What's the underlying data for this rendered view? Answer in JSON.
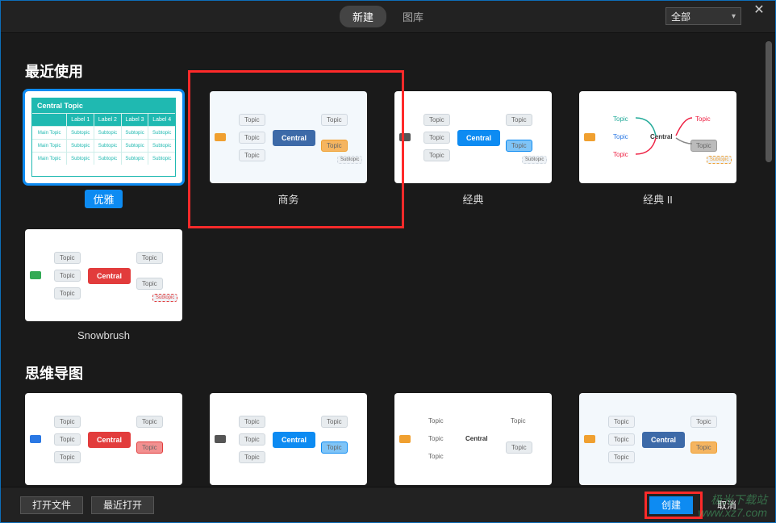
{
  "topbar": {
    "tabs": {
      "new": "新建",
      "gallery": "图库"
    },
    "filter": {
      "selected": "全部"
    }
  },
  "sections": {
    "recent": {
      "title": "最近使用",
      "items": [
        {
          "label": "优雅"
        },
        {
          "label": "商务"
        },
        {
          "label": "经典"
        },
        {
          "label": "经典 II"
        },
        {
          "label": "Snowbrush"
        }
      ]
    },
    "mindmap": {
      "title": "思维导图",
      "items": [
        {
          "label": ""
        },
        {
          "label": ""
        },
        {
          "label": ""
        },
        {
          "label": ""
        }
      ]
    }
  },
  "thumb_text": {
    "central": "Central",
    "central_topic": "Central Topic",
    "topic": "Topic",
    "main_topic": "Main Topic",
    "subtopic": "Subtopic",
    "labels": [
      "Label 1",
      "Label 2",
      "Label 3",
      "Label 4"
    ]
  },
  "bottombar": {
    "open_file": "打开文件",
    "open_recent": "最近打开",
    "create": "创建",
    "cancel": "取消"
  },
  "watermark": {
    "line1": "极光下载站",
    "line2": "www.xz7.com"
  },
  "colors": {
    "accent": "#0d8bf2",
    "highlight": "#ff2a2a",
    "teal": "#1fb9b1",
    "red": "#e23c3c",
    "blue": "#2a78e4",
    "orange": "#f0a030"
  }
}
